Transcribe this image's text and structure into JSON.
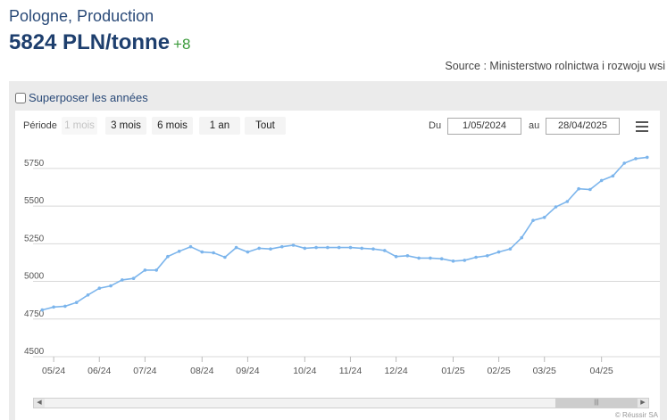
{
  "header": {
    "title": "Pologne, Production",
    "price": "5824 PLN/tonne",
    "change": "+8",
    "source": "Source : Ministerstwo rolnictwa i rozwoju wsi"
  },
  "overlay_label": "Superposer les années",
  "toolbar": {
    "periode_label": "Période",
    "ranges": [
      {
        "label": "1 mois",
        "enabled": false
      },
      {
        "label": "3 mois",
        "enabled": true
      },
      {
        "label": "6 mois",
        "enabled": true
      },
      {
        "label": "1 an",
        "enabled": true
      },
      {
        "label": "Tout",
        "enabled": true
      }
    ],
    "du_label": "Du",
    "from_date": "1/05/2024",
    "au_label": "au",
    "to_date": "28/04/2025",
    "menu_icon": "hamburger-menu-icon"
  },
  "credit": "© Réussir SA",
  "colors": {
    "series": "#7cb5ec",
    "grid": "#d8d8d8",
    "title": "#2a4a78",
    "change": "#3a9a3a"
  },
  "chart_data": {
    "type": "line",
    "title": "",
    "xlabel": "",
    "ylabel": "",
    "ylim": [
      4500,
      5850
    ],
    "y_ticks": [
      4500,
      4750,
      5000,
      5250,
      5500,
      5750
    ],
    "x_ticks": [
      {
        "label": "05/24",
        "date": "2024-05-06"
      },
      {
        "label": "06/24",
        "date": "2024-06-03"
      },
      {
        "label": "07/24",
        "date": "2024-07-01"
      },
      {
        "label": "08/24",
        "date": "2024-08-05"
      },
      {
        "label": "09/24",
        "date": "2024-09-02"
      },
      {
        "label": "10/24",
        "date": "2024-10-07"
      },
      {
        "label": "11/24",
        "date": "2024-11-04"
      },
      {
        "label": "12/24",
        "date": "2024-12-02"
      },
      {
        "label": "01/25",
        "date": "2025-01-06"
      },
      {
        "label": "02/25",
        "date": "2025-02-03"
      },
      {
        "label": "03/25",
        "date": "2025-03-03"
      },
      {
        "label": "04/25",
        "date": "2025-04-07"
      }
    ],
    "x_range": [
      "2024-05-01",
      "2025-04-28"
    ],
    "grid": true,
    "legend": "none",
    "series": [
      {
        "points": [
          [
            "2024-04-29",
            4810
          ],
          [
            "2024-05-06",
            4830
          ],
          [
            "2024-05-13",
            4835
          ],
          [
            "2024-05-20",
            4860
          ],
          [
            "2024-05-27",
            4910
          ],
          [
            "2024-06-03",
            4955
          ],
          [
            "2024-06-10",
            4970
          ],
          [
            "2024-06-17",
            5010
          ],
          [
            "2024-06-24",
            5020
          ],
          [
            "2024-07-01",
            5075
          ],
          [
            "2024-07-08",
            5075
          ],
          [
            "2024-07-15",
            5165
          ],
          [
            "2024-07-22",
            5200
          ],
          [
            "2024-07-29",
            5230
          ],
          [
            "2024-08-05",
            5195
          ],
          [
            "2024-08-12",
            5190
          ],
          [
            "2024-08-19",
            5160
          ],
          [
            "2024-08-26",
            5225
          ],
          [
            "2024-09-02",
            5195
          ],
          [
            "2024-09-09",
            5220
          ],
          [
            "2024-09-16",
            5215
          ],
          [
            "2024-09-23",
            5230
          ],
          [
            "2024-09-30",
            5240
          ],
          [
            "2024-10-07",
            5220
          ],
          [
            "2024-10-14",
            5225
          ],
          [
            "2024-10-21",
            5225
          ],
          [
            "2024-10-28",
            5225
          ],
          [
            "2024-11-04",
            5225
          ],
          [
            "2024-11-11",
            5220
          ],
          [
            "2024-11-18",
            5215
          ],
          [
            "2024-11-25",
            5205
          ],
          [
            "2024-12-02",
            5165
          ],
          [
            "2024-12-09",
            5170
          ],
          [
            "2024-12-16",
            5155
          ],
          [
            "2024-12-23",
            5155
          ],
          [
            "2024-12-30",
            5150
          ],
          [
            "2025-01-06",
            5135
          ],
          [
            "2025-01-13",
            5140
          ],
          [
            "2025-01-20",
            5160
          ],
          [
            "2025-01-27",
            5170
          ],
          [
            "2025-02-03",
            5195
          ],
          [
            "2025-02-10",
            5215
          ],
          [
            "2025-02-17",
            5290
          ],
          [
            "2025-02-24",
            5405
          ],
          [
            "2025-03-03",
            5425
          ],
          [
            "2025-03-10",
            5495
          ],
          [
            "2025-03-17",
            5530
          ],
          [
            "2025-03-24",
            5615
          ],
          [
            "2025-03-31",
            5610
          ],
          [
            "2025-04-07",
            5670
          ],
          [
            "2025-04-14",
            5700
          ],
          [
            "2025-04-21",
            5785
          ],
          [
            "2025-04-28",
            5815
          ],
          [
            "2025-05-05",
            5824
          ]
        ]
      }
    ]
  }
}
